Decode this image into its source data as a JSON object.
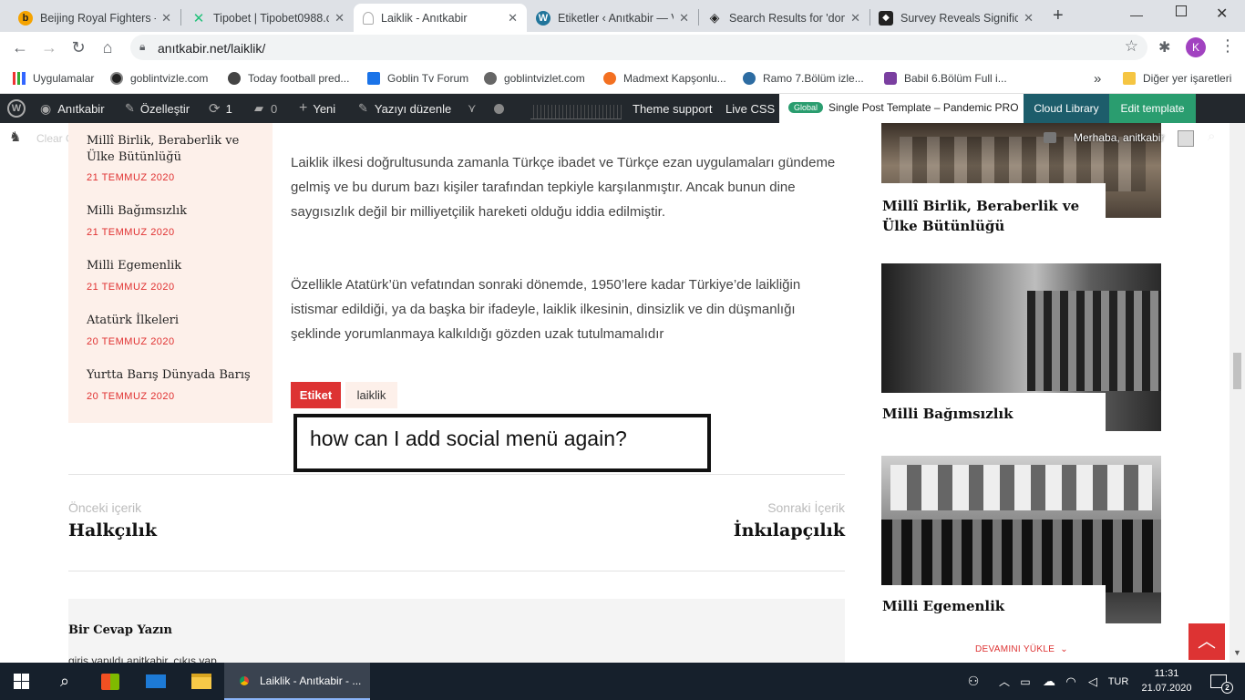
{
  "tabs": [
    {
      "label": "Beijing Royal Fighters -",
      "fav": "b",
      "color": "#f5a300"
    },
    {
      "label": "Tipobet | Tipobet0988.c",
      "fav": "✕",
      "color": "#21c17a"
    },
    {
      "label": "Laiklik - Anıtkabir",
      "fav": "",
      "color": "#888"
    },
    {
      "label": "Etiketler ‹ Anıtkabir — V",
      "fav": "W",
      "color": "#21759b"
    },
    {
      "label": "Search Results for 'dont",
      "fav": "",
      "color": "#222"
    },
    {
      "label": "Survey Reveals Significa",
      "fav": "",
      "color": "#222"
    }
  ],
  "browser": {
    "url": "anıtkabir.net/laiklik/",
    "avatar": "K",
    "new_tab": "+"
  },
  "bookmarks": [
    {
      "label": "Uygulamalar"
    },
    {
      "label": "goblintvizle.com"
    },
    {
      "label": "Today football pred..."
    },
    {
      "label": "Goblin Tv Forum"
    },
    {
      "label": "goblintvizlet.com"
    },
    {
      "label": "Madmext Kapşonlu..."
    },
    {
      "label": "Ramo 7.Bölüm izle..."
    },
    {
      "label": "Babil 6.Bölüm Full i..."
    }
  ],
  "bookmarks_other": "Diğer yer işaretleri",
  "adminbar": {
    "site": "Anıtkabir",
    "customize": "Özelleştir",
    "updates": "1",
    "comments": "0",
    "new": "Yeni",
    "edit": "Yazıyı düzenle",
    "theme_support": "Theme support",
    "live_css": "Live CSS",
    "global_badge": "Global",
    "template": "Single Post Template – Pandemic PRO",
    "cloud_library": "Cloud Library",
    "edit_template": "Edit template",
    "greeting": "Merhaba, anitkabir",
    "clear_cache": "Clear Cache"
  },
  "sidebar_left": [
    {
      "title": "Millî Birlik, Beraberlik ve Ülke Bütünlüğü",
      "date": "21 TEMMUZ 2020"
    },
    {
      "title": "Milli Bağımsızlık",
      "date": "21 TEMMUZ 2020"
    },
    {
      "title": "Milli Egemenlik",
      "date": "21 TEMMUZ 2020"
    },
    {
      "title": "Atatürk İlkeleri",
      "date": "20 TEMMUZ 2020"
    },
    {
      "title": "Yurtta Barış Dünyada Barış",
      "date": "20 TEMMUZ 2020"
    }
  ],
  "article": {
    "p1": "Laiklik ilkesi doğrultusunda zamanla Türkçe ibadet ve Türkçe ezan uygulamaları gündeme gelmiş ve bu durum bazı kişiler tarafından tepkiyle karşılanmıştır. Ancak bunun dine saygısızlık değil bir milliyetçilik hareketi olduğu iddia edilmiştir.",
    "p2": "Özellikle Atatürk’ün vefatından sonraki dönemde, 1950’lere kadar Türkiye’de laikliğin istismar edildiği, ya da başka bir ifadeyle, laiklik ilkesinin, dinsizlik ve din düşmanlığı şeklinde yorumlanmaya kalkıldığı gözden uzak tutulmamalıdır",
    "tag_label": "Etiket",
    "tag": "laiklik",
    "annotation": "how can I add social menü again?"
  },
  "post_nav": {
    "prev_label": "Önceki içerik",
    "prev_title": "Halkçılık",
    "next_label": "Sonraki İçerik",
    "next_title": "İnkılapçılık"
  },
  "comments": {
    "heading": "Bir Cevap Yazın",
    "logged_in": "giriş yapıldı anitkabir. çıkış yap"
  },
  "sidebar_right": [
    {
      "title": "Millî Birlik, Beraberlik ve Ülke Bütünlüğü"
    },
    {
      "title": "Milli Bağımsızlık"
    },
    {
      "title": "Milli Egemenlik"
    }
  ],
  "load_more": "DEVAMINI YÜKLE",
  "taskbar": {
    "app_label": "Laiklik - Anıtkabir - ...",
    "lang": "TUR",
    "time": "11:31",
    "date": "21.07.2020",
    "notifications": "2"
  },
  "colors": {
    "accent_red": "#dd3333",
    "wp_bar": "#23282d",
    "cloud_library": "#1d5d6b",
    "edit_template": "#2a9d6f",
    "pink_panel": "#fdf0ea"
  }
}
